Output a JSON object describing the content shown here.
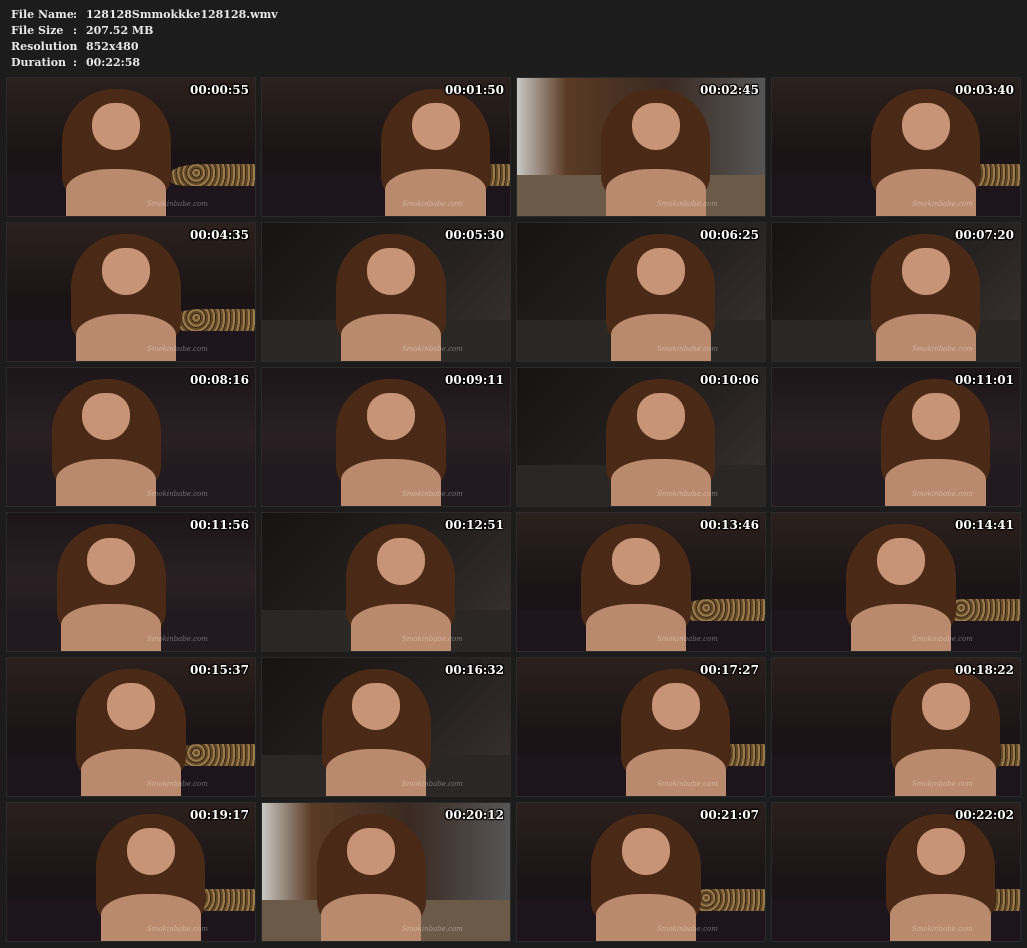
{
  "file_info": {
    "file_name_label": "File Name",
    "file_name_value": "128128Smmokkke128128.wmv",
    "file_size_label": "File Size",
    "file_size_value": "207.52 MB",
    "resolution_label": "Resolution",
    "resolution_value": "852x480",
    "duration_label": "Duration",
    "duration_value": "00:22:58",
    "separator": ":"
  },
  "colors": {
    "page_background": "#1c1c1c",
    "text": "#e8e8e8",
    "hair": "#4a2a16",
    "skin": "#c89478",
    "bedding_dark": "#1a1418"
  },
  "thumbnails": [
    {
      "timestamp": "00:00:55",
      "watermark": "Smokinbabe.com",
      "scene": "bed"
    },
    {
      "timestamp": "00:01:50",
      "watermark": "Smokinbabe.com",
      "scene": "bed"
    },
    {
      "timestamp": "00:02:45",
      "watermark": "Smokinbabe.com",
      "scene": "room"
    },
    {
      "timestamp": "00:03:40",
      "watermark": "Smokinbabe.com",
      "scene": "bed"
    },
    {
      "timestamp": "00:04:35",
      "watermark": "Smokinbabe.com",
      "scene": "bed"
    },
    {
      "timestamp": "00:05:30",
      "watermark": "Smokinbabe.com",
      "scene": "studio"
    },
    {
      "timestamp": "00:06:25",
      "watermark": "Smokinbabe.com",
      "scene": "studio"
    },
    {
      "timestamp": "00:07:20",
      "watermark": "Smokinbabe.com",
      "scene": "studio"
    },
    {
      "timestamp": "00:08:16",
      "watermark": "Smokinbabe.com",
      "scene": "lying"
    },
    {
      "timestamp": "00:09:11",
      "watermark": "Smokinbabe.com",
      "scene": "lying"
    },
    {
      "timestamp": "00:10:06",
      "watermark": "Smokinbabe.com",
      "scene": "studio"
    },
    {
      "timestamp": "00:11:01",
      "watermark": "Smokinbabe.com",
      "scene": "lying"
    },
    {
      "timestamp": "00:11:56",
      "watermark": "Smokinbabe.com",
      "scene": "lying"
    },
    {
      "timestamp": "00:12:51",
      "watermark": "Smokinbabe.com",
      "scene": "studio"
    },
    {
      "timestamp": "00:13:46",
      "watermark": "Smokinbabe.com",
      "scene": "bed"
    },
    {
      "timestamp": "00:14:41",
      "watermark": "Smokinbabe.com",
      "scene": "bed"
    },
    {
      "timestamp": "00:15:37",
      "watermark": "Smokinbabe.com",
      "scene": "bed"
    },
    {
      "timestamp": "00:16:32",
      "watermark": "Smokinbabe.com",
      "scene": "studio"
    },
    {
      "timestamp": "00:17:27",
      "watermark": "Smokinbabe.com",
      "scene": "bed"
    },
    {
      "timestamp": "00:18:22",
      "watermark": "Smokinbabe.com",
      "scene": "bed"
    },
    {
      "timestamp": "00:19:17",
      "watermark": "Smokinbabe.com",
      "scene": "bed"
    },
    {
      "timestamp": "00:20:12",
      "watermark": "Smokinbabe.com",
      "scene": "room"
    },
    {
      "timestamp": "00:21:07",
      "watermark": "Smokinbabe.com",
      "scene": "bed"
    },
    {
      "timestamp": "00:22:02",
      "watermark": "Smokinbabe.com",
      "scene": "bed"
    }
  ]
}
